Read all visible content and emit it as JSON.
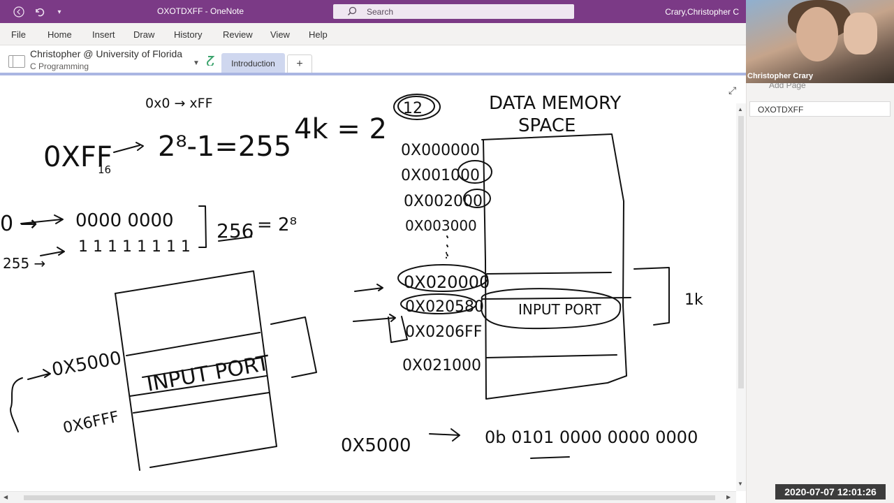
{
  "titlebar": {
    "doc_title": "OXOTDXFF  -  OneNote",
    "search_placeholder": "Search",
    "user": "Crary,Christopher C"
  },
  "menu": {
    "items": [
      "File",
      "Home",
      "Insert",
      "Draw",
      "History",
      "Review",
      "View",
      "Help"
    ]
  },
  "notebook": {
    "name": "Christopher @ University of Florida",
    "section": "C Programming",
    "tab_label": "Introduction",
    "add_tab": "+"
  },
  "page_pane": {
    "add_page": "Add Page",
    "pages": [
      "OXOTDXFF"
    ]
  },
  "video": {
    "participant": "Christopher Crary"
  },
  "timestamp": "2020-07-07  12:01:26",
  "ink": {
    "top_note": "0x0 → xFF",
    "hex_ff": "0XFF",
    "base": "16",
    "pow_eq": "2⁸-1=255",
    "four_k": "4k = 2",
    "exp12": "12",
    "zero_arrow": "0 →",
    "bits0": "0000 0000",
    "two55": "255 →",
    "bits1": "1 1 1 1 1 1 1 1",
    "n256": "256",
    "eq_28": "= 2⁸",
    "mem_title1": "DATA MEMORY",
    "mem_title2": "SPACE",
    "addresses": [
      "0X000000",
      "0X001000",
      "0X002000",
      "0X003000",
      ":",
      "0X020000",
      "0X020580",
      "0X0206FF",
      "0X021000"
    ],
    "input_port": "INPUT PORT",
    "input_port_small": "INPUT PORT",
    "one_k": "1k",
    "addr_5000": "0X5000",
    "addr_6fff": "0X6FFF",
    "conv_left": "0X5000",
    "conv_bin": "0b 0101 0000 0000 0000"
  }
}
